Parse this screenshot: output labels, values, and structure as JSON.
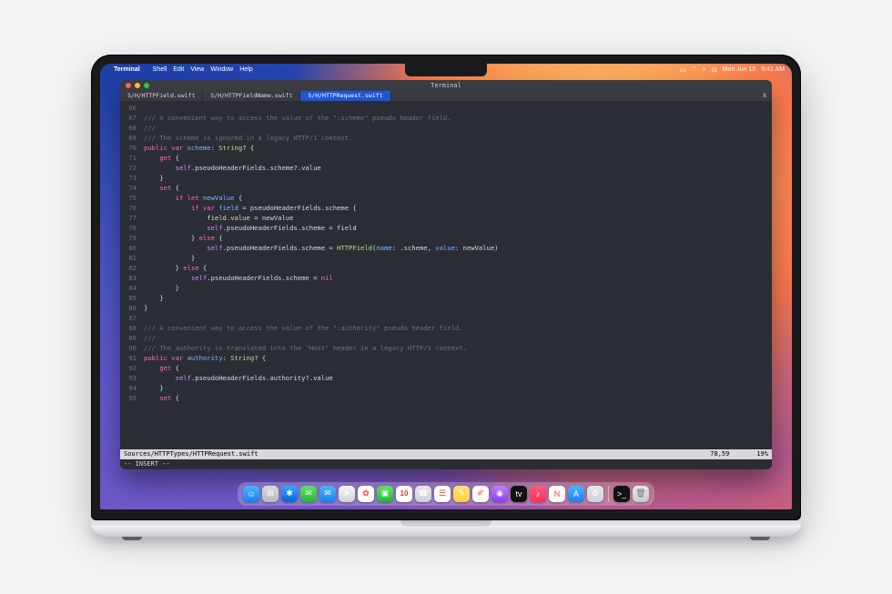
{
  "menubar": {
    "app": "Terminal",
    "items": [
      "Shell",
      "Edit",
      "View",
      "Window",
      "Help"
    ],
    "right": {
      "date": "Mon Jun 10",
      "time": "9:41 AM"
    }
  },
  "terminal": {
    "title": "Terminal",
    "tabs": [
      {
        "label": "S/H/HTTPField.swift",
        "active": false
      },
      {
        "label": "S/H/HTTPFieldName.swift",
        "active": false
      },
      {
        "label": "S/H/HTTPRequest.swift",
        "active": true
      }
    ],
    "tab_close": "X",
    "status": {
      "path": "Sources/HTTPTypes/HTTPRequest.swift",
      "pos": "78,59",
      "pct": "19%"
    },
    "mode": "-- INSERT --",
    "lines": [
      {
        "n": "66",
        "t": ""
      },
      {
        "n": "67",
        "t": "/// A convenient way to access the value of the \":scheme\" pseudo header field.",
        "cls": "c-comment"
      },
      {
        "n": "68",
        "t": "///",
        "cls": "c-comment"
      },
      {
        "n": "69",
        "t": "/// The scheme is ignored in a legacy HTTP/1 context.",
        "cls": "c-comment"
      },
      {
        "n": "70",
        "seg": [
          [
            "public ",
            "c-kw"
          ],
          [
            "var ",
            "c-kw"
          ],
          [
            "scheme",
            "c-ident"
          ],
          [
            ": ",
            ""
          ],
          [
            "String",
            "c-type"
          ],
          [
            "? {",
            ""
          ]
        ]
      },
      {
        "n": "71",
        "seg": [
          [
            "    ",
            ""
          ],
          [
            "get",
            " c-kw"
          ],
          [
            " {",
            ""
          ]
        ]
      },
      {
        "n": "72",
        "seg": [
          [
            "        ",
            ""
          ],
          [
            "self",
            "c-self"
          ],
          [
            ".pseudoHeaderFields.scheme?.value",
            ""
          ]
        ]
      },
      {
        "n": "73",
        "t": "    }"
      },
      {
        "n": "74",
        "seg": [
          [
            "    ",
            ""
          ],
          [
            "set",
            "c-kw"
          ],
          [
            " {",
            ""
          ]
        ]
      },
      {
        "n": "75",
        "seg": [
          [
            "        ",
            ""
          ],
          [
            "if let ",
            "c-kw"
          ],
          [
            "newValue",
            "c-ident"
          ],
          [
            " {",
            ""
          ]
        ]
      },
      {
        "n": "76",
        "seg": [
          [
            "            ",
            ""
          ],
          [
            "if var ",
            "c-kw"
          ],
          [
            "field",
            "c-ident"
          ],
          [
            " = pseudoHeaderFields.scheme {",
            ""
          ]
        ]
      },
      {
        "n": "77",
        "seg": [
          [
            "                field.value = newValue",
            ""
          ]
        ]
      },
      {
        "n": "78",
        "seg": [
          [
            "                ",
            ""
          ],
          [
            "self",
            "c-self"
          ],
          [
            ".pseudoHeaderFields.scheme = field",
            ""
          ]
        ]
      },
      {
        "n": "79",
        "seg": [
          [
            "            } ",
            ""
          ],
          [
            "else",
            "c-kw"
          ],
          [
            " {",
            ""
          ]
        ]
      },
      {
        "n": "80",
        "seg": [
          [
            "                ",
            ""
          ],
          [
            "self",
            "c-self"
          ],
          [
            ".pseudoHeaderFields.scheme = ",
            ""
          ],
          [
            "HTTPField",
            "c-fn"
          ],
          [
            "(",
            ""
          ],
          [
            "name",
            "c-param"
          ],
          [
            ": .scheme, ",
            ""
          ],
          [
            "value",
            "c-param"
          ],
          [
            ": newValue)",
            ""
          ]
        ]
      },
      {
        "n": "81",
        "t": "            }"
      },
      {
        "n": "82",
        "seg": [
          [
            "        } ",
            ""
          ],
          [
            "else",
            "c-kw"
          ],
          [
            " {",
            ""
          ]
        ]
      },
      {
        "n": "83",
        "seg": [
          [
            "            ",
            ""
          ],
          [
            "self",
            "c-self"
          ],
          [
            ".pseudoHeaderFields.scheme = ",
            ""
          ],
          [
            "nil",
            "c-kw"
          ]
        ]
      },
      {
        "n": "84",
        "t": "        }"
      },
      {
        "n": "85",
        "t": "    }"
      },
      {
        "n": "86",
        "t": "}"
      },
      {
        "n": "87",
        "t": ""
      },
      {
        "n": "88",
        "t": "/// A convenient way to access the value of the \":authority\" pseudo header field.",
        "cls": "c-comment"
      },
      {
        "n": "89",
        "t": "///",
        "cls": "c-comment"
      },
      {
        "n": "90",
        "t": "/// The authority is translated into the \"Host\" header in a legacy HTTP/1 context.",
        "cls": "c-comment"
      },
      {
        "n": "91",
        "seg": [
          [
            "public ",
            "c-kw"
          ],
          [
            "var ",
            "c-kw"
          ],
          [
            "authority",
            "c-ident"
          ],
          [
            ": ",
            ""
          ],
          [
            "String",
            "c-type"
          ],
          [
            "? {",
            ""
          ]
        ]
      },
      {
        "n": "92",
        "seg": [
          [
            "    ",
            ""
          ],
          [
            "get",
            "c-kw"
          ],
          [
            " {",
            ""
          ]
        ]
      },
      {
        "n": "93",
        "seg": [
          [
            "        ",
            ""
          ],
          [
            "self",
            "c-self"
          ],
          [
            ".pseudoHeaderFields.authority?.value",
            ""
          ]
        ]
      },
      {
        "n": "94",
        "t": "    }"
      },
      {
        "n": "95",
        "seg": [
          [
            "    ",
            ""
          ],
          [
            "set",
            "c-kw"
          ],
          [
            " {",
            ""
          ]
        ]
      }
    ]
  },
  "dock": [
    {
      "name": "finder",
      "bg": "linear-gradient(#4ab4ff,#1e7ef0)",
      "g": "☺"
    },
    {
      "name": "launchpad",
      "bg": "linear-gradient(#d9dbe0,#b8bac0)",
      "g": "⊞"
    },
    {
      "name": "safari",
      "bg": "linear-gradient(#36a7ff,#0b62d6)",
      "g": "✱"
    },
    {
      "name": "messages",
      "bg": "linear-gradient(#62e06a,#1fb83a)",
      "g": "✉"
    },
    {
      "name": "mail",
      "bg": "linear-gradient(#4ab4ff,#1e7ef0)",
      "g": "✉"
    },
    {
      "name": "maps",
      "bg": "linear-gradient(#f5f5f7,#d3d3d7)",
      "g": "➤"
    },
    {
      "name": "photos",
      "bg": "#fff",
      "g": "✿"
    },
    {
      "name": "facetime",
      "bg": "linear-gradient(#62e06a,#1fb83a)",
      "g": "▣"
    },
    {
      "name": "calendar",
      "bg": "#fff",
      "g": "10"
    },
    {
      "name": "contacts",
      "bg": "linear-gradient(#e9e9ec,#cfd0d4)",
      "g": "☎"
    },
    {
      "name": "reminders",
      "bg": "#fff",
      "g": "☰"
    },
    {
      "name": "notes",
      "bg": "linear-gradient(#ffe27a,#ffcf3e)",
      "g": "✎"
    },
    {
      "name": "freeform",
      "bg": "#fff",
      "g": "✐"
    },
    {
      "name": "podcasts",
      "bg": "linear-gradient(#c080ff,#8a3df0)",
      "g": "◉"
    },
    {
      "name": "tv",
      "bg": "#111",
      "g": "tv"
    },
    {
      "name": "music",
      "bg": "linear-gradient(#ff5a7a,#ff2d55)",
      "g": "♪"
    },
    {
      "name": "news",
      "bg": "#fff",
      "g": "N"
    },
    {
      "name": "appstore",
      "bg": "linear-gradient(#4ab4ff,#1e7ef0)",
      "g": "A"
    },
    {
      "name": "settings",
      "bg": "linear-gradient(#e9e9ec,#cfd0d4)",
      "g": "⚙"
    },
    {
      "name": "sep"
    },
    {
      "name": "terminal",
      "bg": "#111",
      "g": ">_"
    },
    {
      "name": "trash",
      "bg": "trash",
      "g": "🗑"
    }
  ]
}
